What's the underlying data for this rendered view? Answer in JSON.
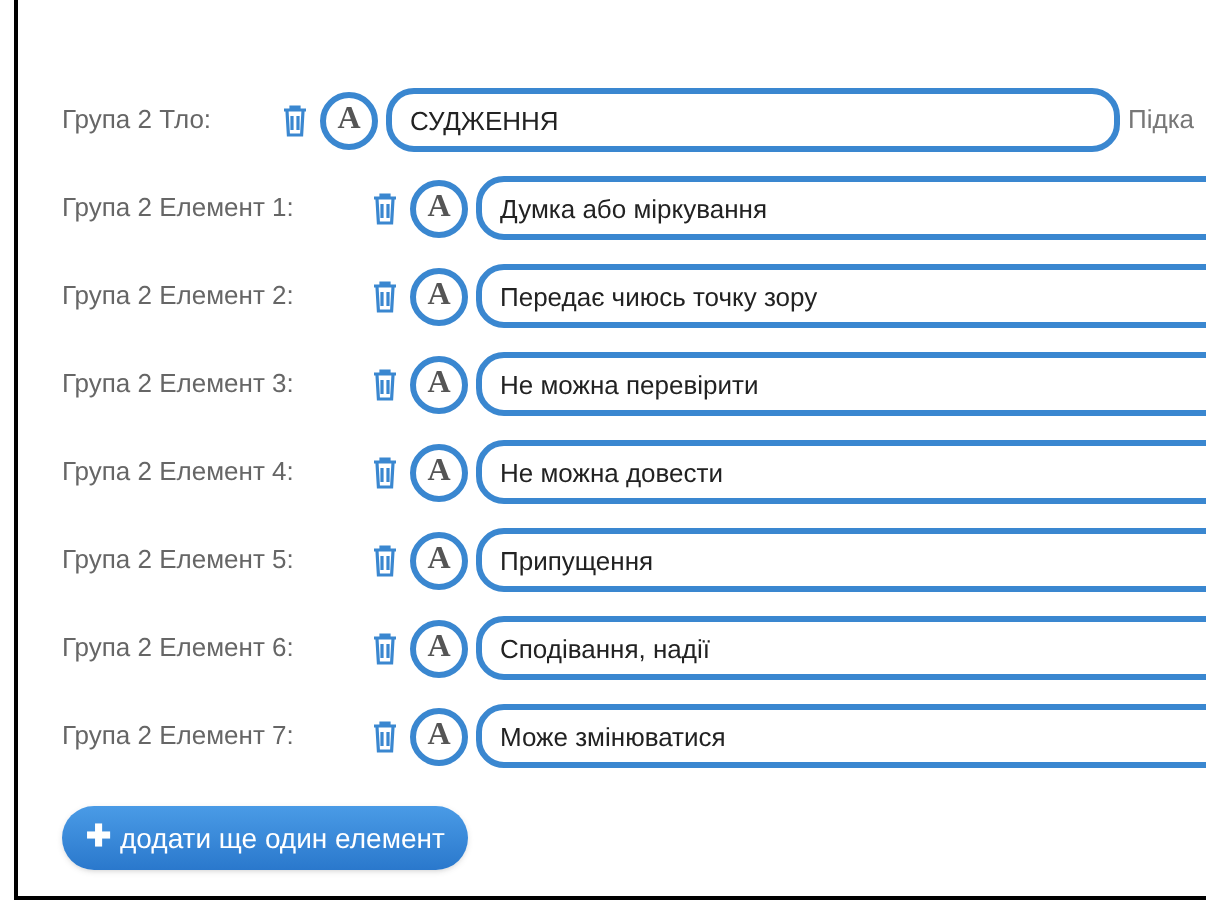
{
  "background_row": {
    "label": "Група 2 Тло:",
    "font_letter": "A",
    "value": "СУДЖЕННЯ",
    "side_label": "Підка"
  },
  "elements": [
    {
      "label": "Група 2 Елемент 1:",
      "font_letter": "A",
      "value": "Думка або міркування"
    },
    {
      "label": "Група 2 Елемент 2:",
      "font_letter": "A",
      "value": "Передає чиюсь точку зору"
    },
    {
      "label": "Група 2 Елемент 3:",
      "font_letter": "A",
      "value": "Не можна перевірити"
    },
    {
      "label": "Група 2 Елемент 4:",
      "font_letter": "A",
      "value": "Не можна довести"
    },
    {
      "label": "Група 2 Елемент 5:",
      "font_letter": "A",
      "value": "Припущення"
    },
    {
      "label": "Група 2 Елемент 6:",
      "font_letter": "A",
      "value": "Сподівання, надії"
    },
    {
      "label": "Група 2 Елемент 7:",
      "font_letter": "A",
      "value": "Може змінюватися"
    }
  ],
  "add_button": {
    "icon": "✚",
    "label": "додати ще один елемент"
  }
}
